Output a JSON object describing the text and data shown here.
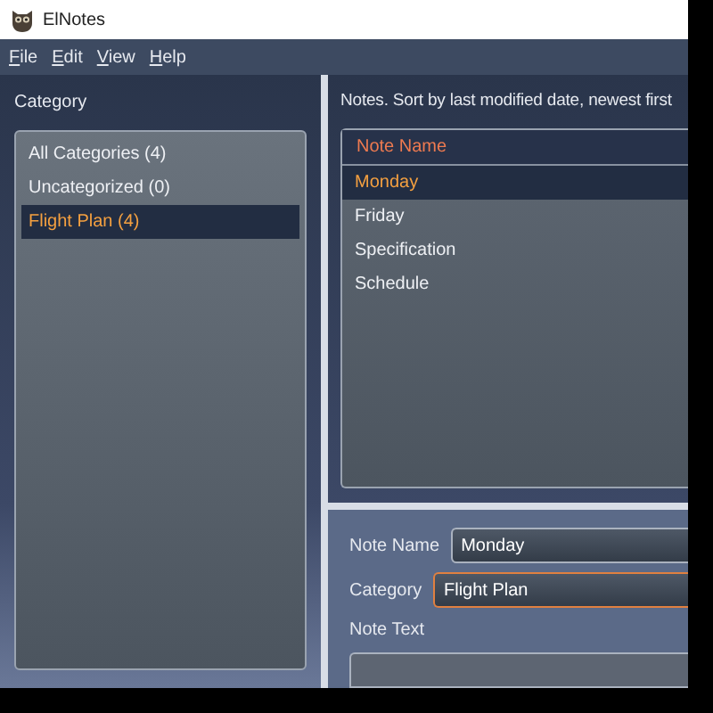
{
  "window": {
    "title": "ElNotes"
  },
  "menu": [
    {
      "label": "File"
    },
    {
      "label": "Edit"
    },
    {
      "label": "View"
    },
    {
      "label": "Help"
    }
  ],
  "category_panel": {
    "heading": "Category",
    "items": [
      {
        "label": "All Categories (4)",
        "selected": false
      },
      {
        "label": "Uncategorized (0)",
        "selected": false
      },
      {
        "label": "Flight Plan (4)",
        "selected": true
      }
    ]
  },
  "notes_panel": {
    "heading": "Notes. Sort by last modified date, newest first",
    "column": "Note Name",
    "notes": [
      {
        "name": "Monday",
        "selected": true
      },
      {
        "name": "Friday",
        "selected": false
      },
      {
        "name": "Specification",
        "selected": false
      },
      {
        "name": "Schedule",
        "selected": false
      }
    ]
  },
  "editor": {
    "note_name_label": "Note Name",
    "note_name": "Monday",
    "category_label": "Category",
    "category": "Flight Plan",
    "note_text_label": "Note Text"
  }
}
